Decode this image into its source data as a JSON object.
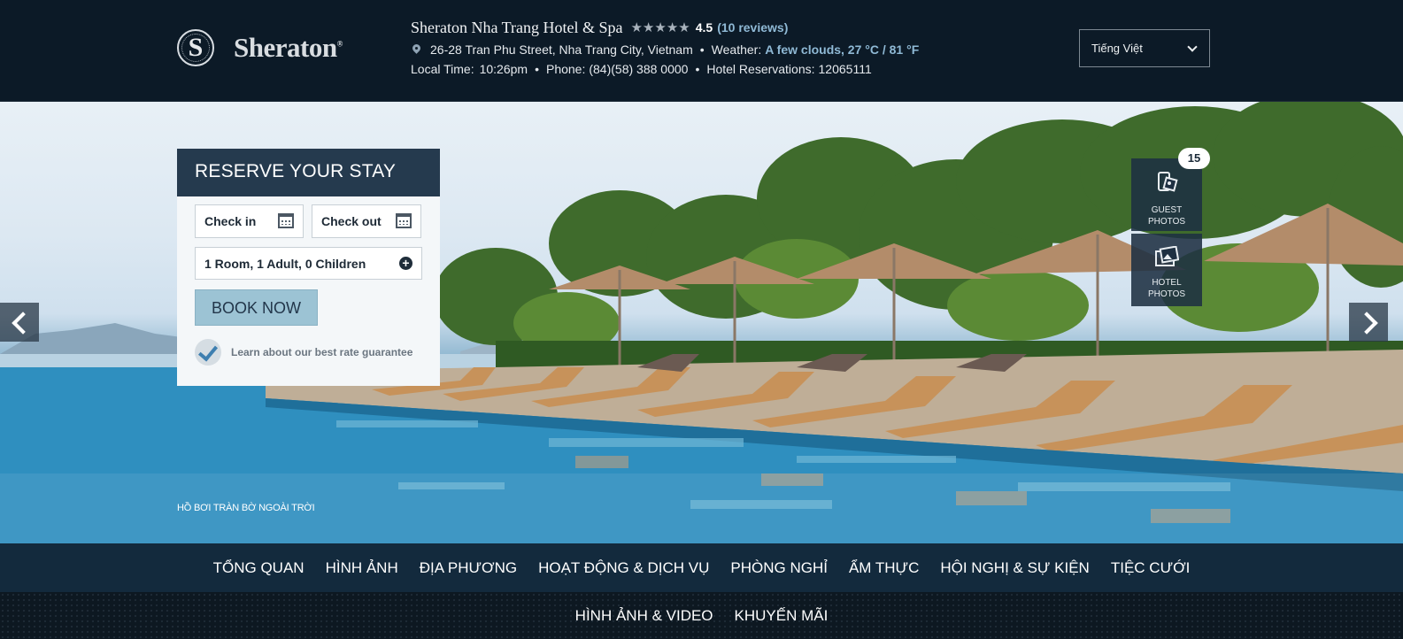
{
  "header": {
    "logo_text": "Sheraton",
    "logo_trademark": "®",
    "logo_letter": "S",
    "hotel_name": "Sheraton Nha Trang Hotel & Spa",
    "stars": "★★★★★",
    "rating": "4.5",
    "reviews": "(10 reviews)",
    "address": "26-28 Tran Phu Street, Nha Trang City, Vietnam",
    "bullet": "•",
    "weather_label": "Weather:",
    "weather_value": "A few clouds, 27 °C / 81 °F",
    "local_time_label": "Local Time:",
    "local_time": "10:26pm",
    "phone_label": "Phone:",
    "phone": "(84)(58) 388 0000",
    "reservations_label": "Hotel Reservations:",
    "reservations": "12065111",
    "language": "Tiếng Việt"
  },
  "reserve": {
    "title": "RESERVE YOUR STAY",
    "check_in": "Check in",
    "check_out": "Check out",
    "guests": "1 Room, 1 Adult, 0 Children",
    "book_button": "BOOK NOW",
    "guarantee": "Learn about our best rate guarantee"
  },
  "gallery": {
    "guest_photos_count": "15",
    "guest_photos_line1": "GUEST",
    "guest_photos_line2": "PHOTOS",
    "hotel_photos_line1": "HOTEL",
    "hotel_photos_line2": "PHOTOS",
    "caption": "HỒ BƠI TRÀN BỜ NGOÀI TRỜI"
  },
  "nav": {
    "items": [
      "TỔNG QUAN",
      "HÌNH ẢNH",
      "ĐỊA PHƯƠNG",
      "HOẠT ĐỘNG & DỊCH VỤ",
      "PHÒNG NGHỈ",
      "ẨM THỰC",
      "HỘI NGHỊ & SỰ KIỆN",
      "TIỆC CƯỚI"
    ],
    "sub_items": [
      "HÌNH ẢNH & VIDEO",
      "KHUYẾN MÃI"
    ]
  },
  "icons": {
    "location": "map-pin-icon",
    "calendar": "calendar-icon",
    "add": "plus-circle-icon",
    "check": "checkmark-icon",
    "prev": "chevron-left-icon",
    "next": "chevron-right-icon",
    "guest_photos": "phone-photo-icon",
    "hotel_photos": "picture-icon",
    "dropdown": "chevron-down-icon"
  }
}
